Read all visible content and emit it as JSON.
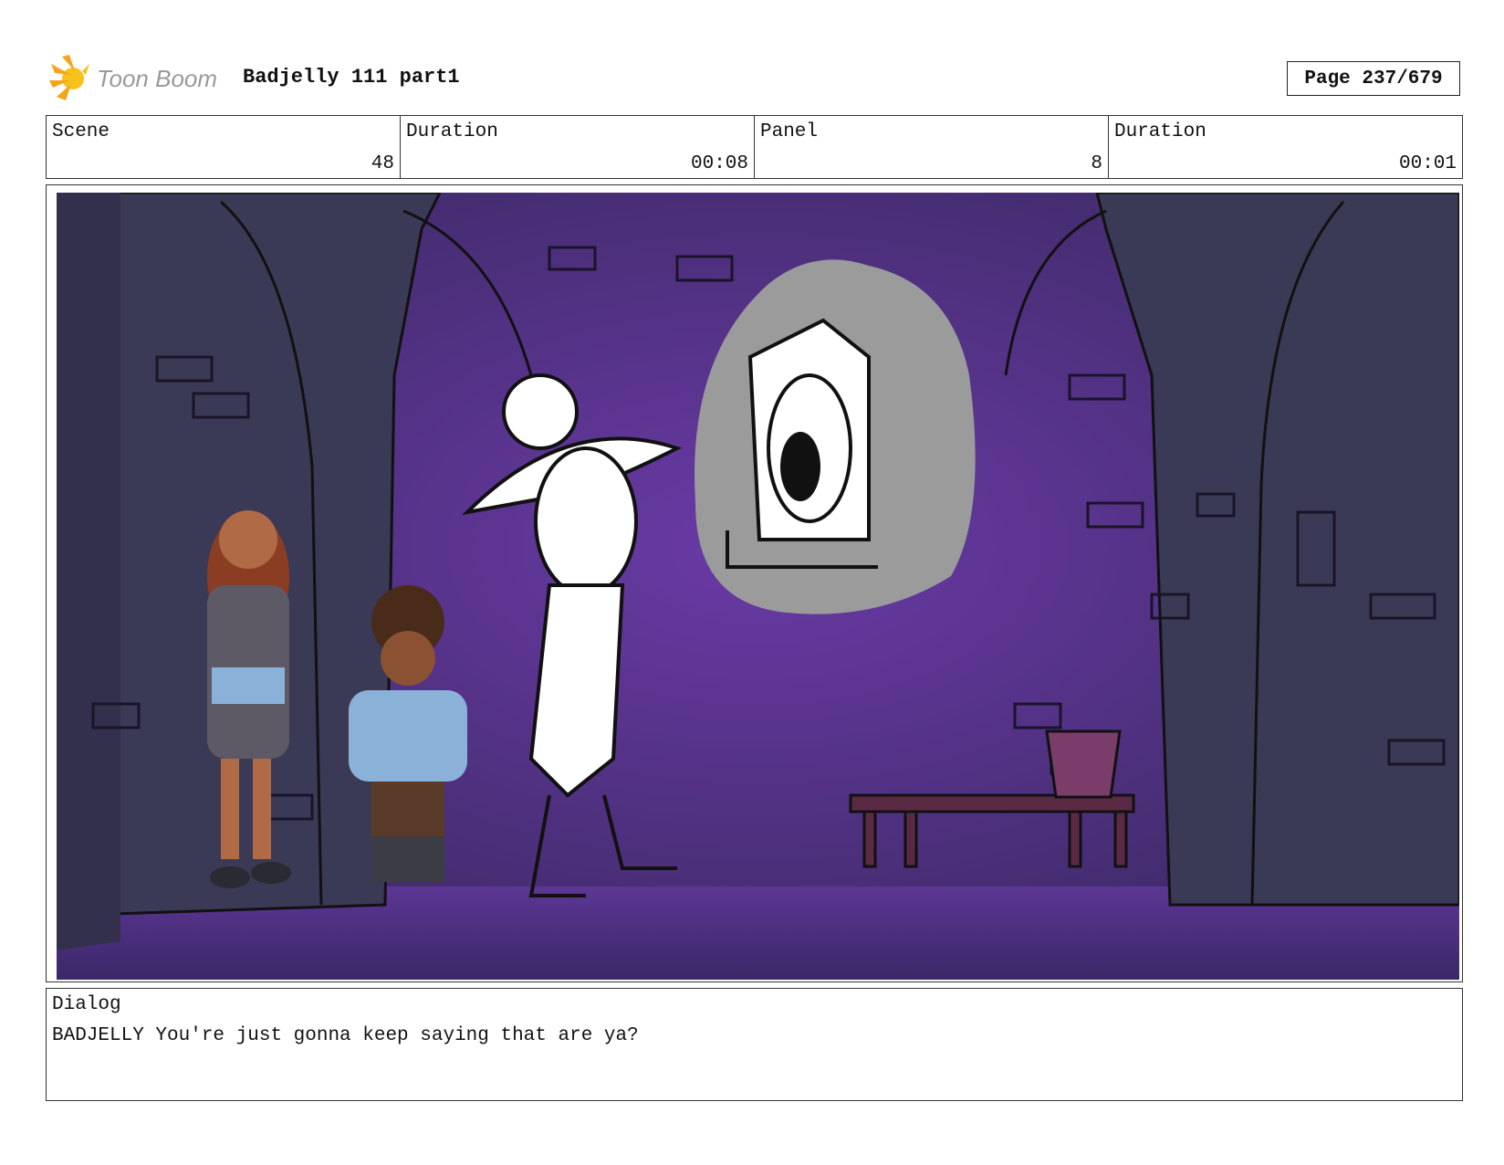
{
  "header": {
    "logo_text": "Toon Boom",
    "title": "Badjelly 111 part1",
    "page": "Page 237/679"
  },
  "info": {
    "scene_label": "Scene",
    "scene_value": "48",
    "scene_duration_label": "Duration",
    "scene_duration_value": "00:08",
    "panel_label": "Panel",
    "panel_value": "8",
    "panel_duration_label": "Duration",
    "panel_duration_value": "00:01"
  },
  "dialog": {
    "label": "Dialog",
    "text": "BADJELLY You're just gonna keep saying that are ya?"
  },
  "colors": {
    "wall": "#4a2f78",
    "pillar": "#3a3650",
    "floor": "#5a3590",
    "thought_bubble": "#9a9a9a"
  }
}
